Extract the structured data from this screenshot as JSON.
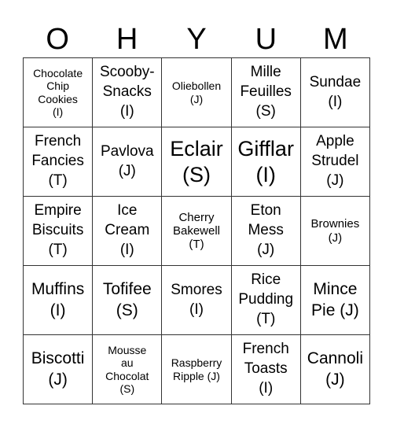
{
  "header": {
    "letters": [
      "O",
      "H",
      "Y",
      "U",
      "M"
    ]
  },
  "board": {
    "cells": [
      {
        "text": "Chocolate\nChip\nCookies\n(I)",
        "size": "s-xs"
      },
      {
        "text": "Scooby-\nSnacks\n(I)",
        "size": "s-md"
      },
      {
        "text": "Oliebollen\n(J)",
        "size": "s-xs"
      },
      {
        "text": "Mille\nFeuilles\n(S)",
        "size": "s-md"
      },
      {
        "text": "Sundae\n(I)",
        "size": "s-md"
      },
      {
        "text": "French\nFancies\n(T)",
        "size": "s-md"
      },
      {
        "text": "Pavlova\n(J)",
        "size": "s-md"
      },
      {
        "text": "Eclair\n(S)",
        "size": "s-xl"
      },
      {
        "text": "Gifflar\n(I)",
        "size": "s-xl"
      },
      {
        "text": "Apple\nStrudel\n(J)",
        "size": "s-md"
      },
      {
        "text": "Empire\nBiscuits\n(T)",
        "size": "s-md"
      },
      {
        "text": "Ice\nCream\n(I)",
        "size": "s-md"
      },
      {
        "text": "Cherry\nBakewell\n(T)",
        "size": "s-sm"
      },
      {
        "text": "Eton\nMess\n(J)",
        "size": "s-md"
      },
      {
        "text": "Brownies\n(J)",
        "size": "s-sm"
      },
      {
        "text": "Muffins\n(I)",
        "size": "s-lg"
      },
      {
        "text": "Tofifee\n(S)",
        "size": "s-lg"
      },
      {
        "text": "Smores\n(I)",
        "size": "s-md"
      },
      {
        "text": "Rice\nPudding\n(T)",
        "size": "s-md"
      },
      {
        "text": "Mince\nPie (J)",
        "size": "s-lg"
      },
      {
        "text": "Biscotti\n(J)",
        "size": "s-lg"
      },
      {
        "text": "Mousse\nau\nChocolat\n(S)",
        "size": "s-xs"
      },
      {
        "text": "Raspberry\nRipple (J)",
        "size": "s-xs"
      },
      {
        "text": "French\nToasts\n(I)",
        "size": "s-md"
      },
      {
        "text": "Cannoli\n(J)",
        "size": "s-lg"
      }
    ]
  }
}
